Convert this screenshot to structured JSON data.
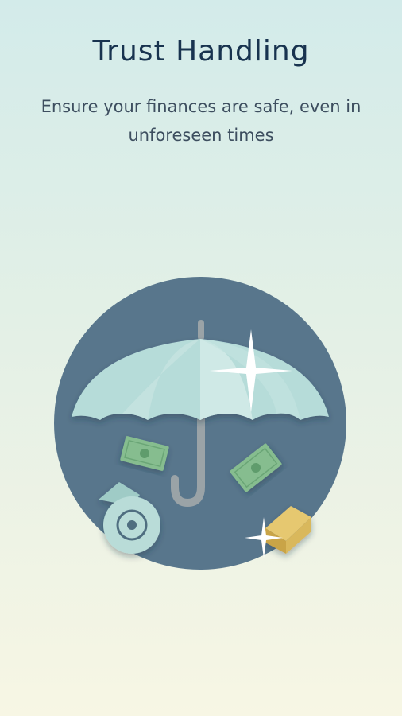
{
  "onboarding": {
    "title": "Trust Handling",
    "subtitle": "Ensure your finances are safe, even in unforeseen times"
  },
  "illustration": {
    "icons": [
      "umbrella-icon",
      "sparkle-icon",
      "banknote-icon",
      "safe-icon",
      "gold-bar-icon"
    ],
    "colors": {
      "circle": "#58768c",
      "umbrella": "#b6dcd9",
      "umbrella_highlight": "#cfe9e6",
      "handle": "#9aa3a7",
      "banknote": "#86bd8f",
      "safe": "#b9dcd8",
      "gold": "#d9b85c"
    }
  }
}
